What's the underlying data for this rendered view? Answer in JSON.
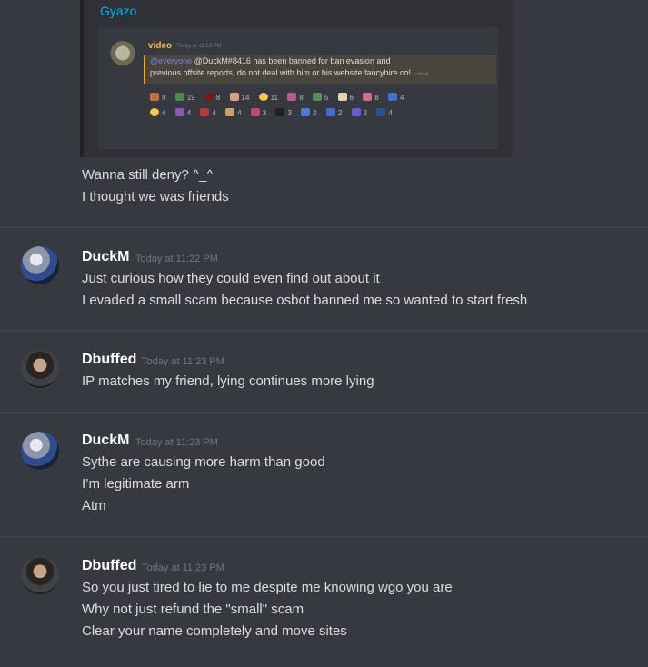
{
  "embed": {
    "provider": "Gyazo",
    "preview": {
      "author": "video",
      "timestamp": "Today at 11:13 PM",
      "mention": "@everyone",
      "text_line1": " @DuckM#8416 has been banned for ban evasion and",
      "text_line2": "previous offsite reports, do not deal with him or his website fancyhire.co!",
      "edited": "(edited)",
      "reactions_row1": [
        "9",
        "19",
        "8",
        "14",
        "11",
        "8",
        "5",
        "6",
        "8",
        "4"
      ],
      "reactions_row2": [
        "4",
        "4",
        "4",
        "4",
        "3",
        "3",
        "2",
        "2",
        "2",
        "4"
      ]
    }
  },
  "continued_message": {
    "lines": [
      "Wanna still deny? ^_^",
      "I thought we was friends"
    ]
  },
  "messages": [
    {
      "author": "DuckM",
      "timestamp": "Today at 11:22 PM",
      "lines": [
        "Just curious how they could even find out about it",
        "I evaded a small scam because osbot banned me so wanted to start fresh"
      ]
    },
    {
      "author": "Dbuffed",
      "timestamp": "Today at 11:23 PM",
      "lines": [
        "IP matches my friend, lying continues more lying"
      ]
    },
    {
      "author": "DuckM",
      "timestamp": "Today at 11:23 PM",
      "lines": [
        "Sythe are causing more harm than good",
        "I’m legitimate arm",
        "Atm"
      ]
    },
    {
      "author": "Dbuffed",
      "timestamp": "Today at 11:23 PM",
      "lines": [
        "So you just tired to lie to me despite me knowing wgo you are",
        "Why not just refund the \"small\" scam",
        "Clear your name completely and move sites"
      ]
    }
  ],
  "colors": {
    "background": "#36393f",
    "embed_bg": "#2f3136",
    "link": "#00b0f4",
    "mention_highlight": "#faa61a"
  }
}
